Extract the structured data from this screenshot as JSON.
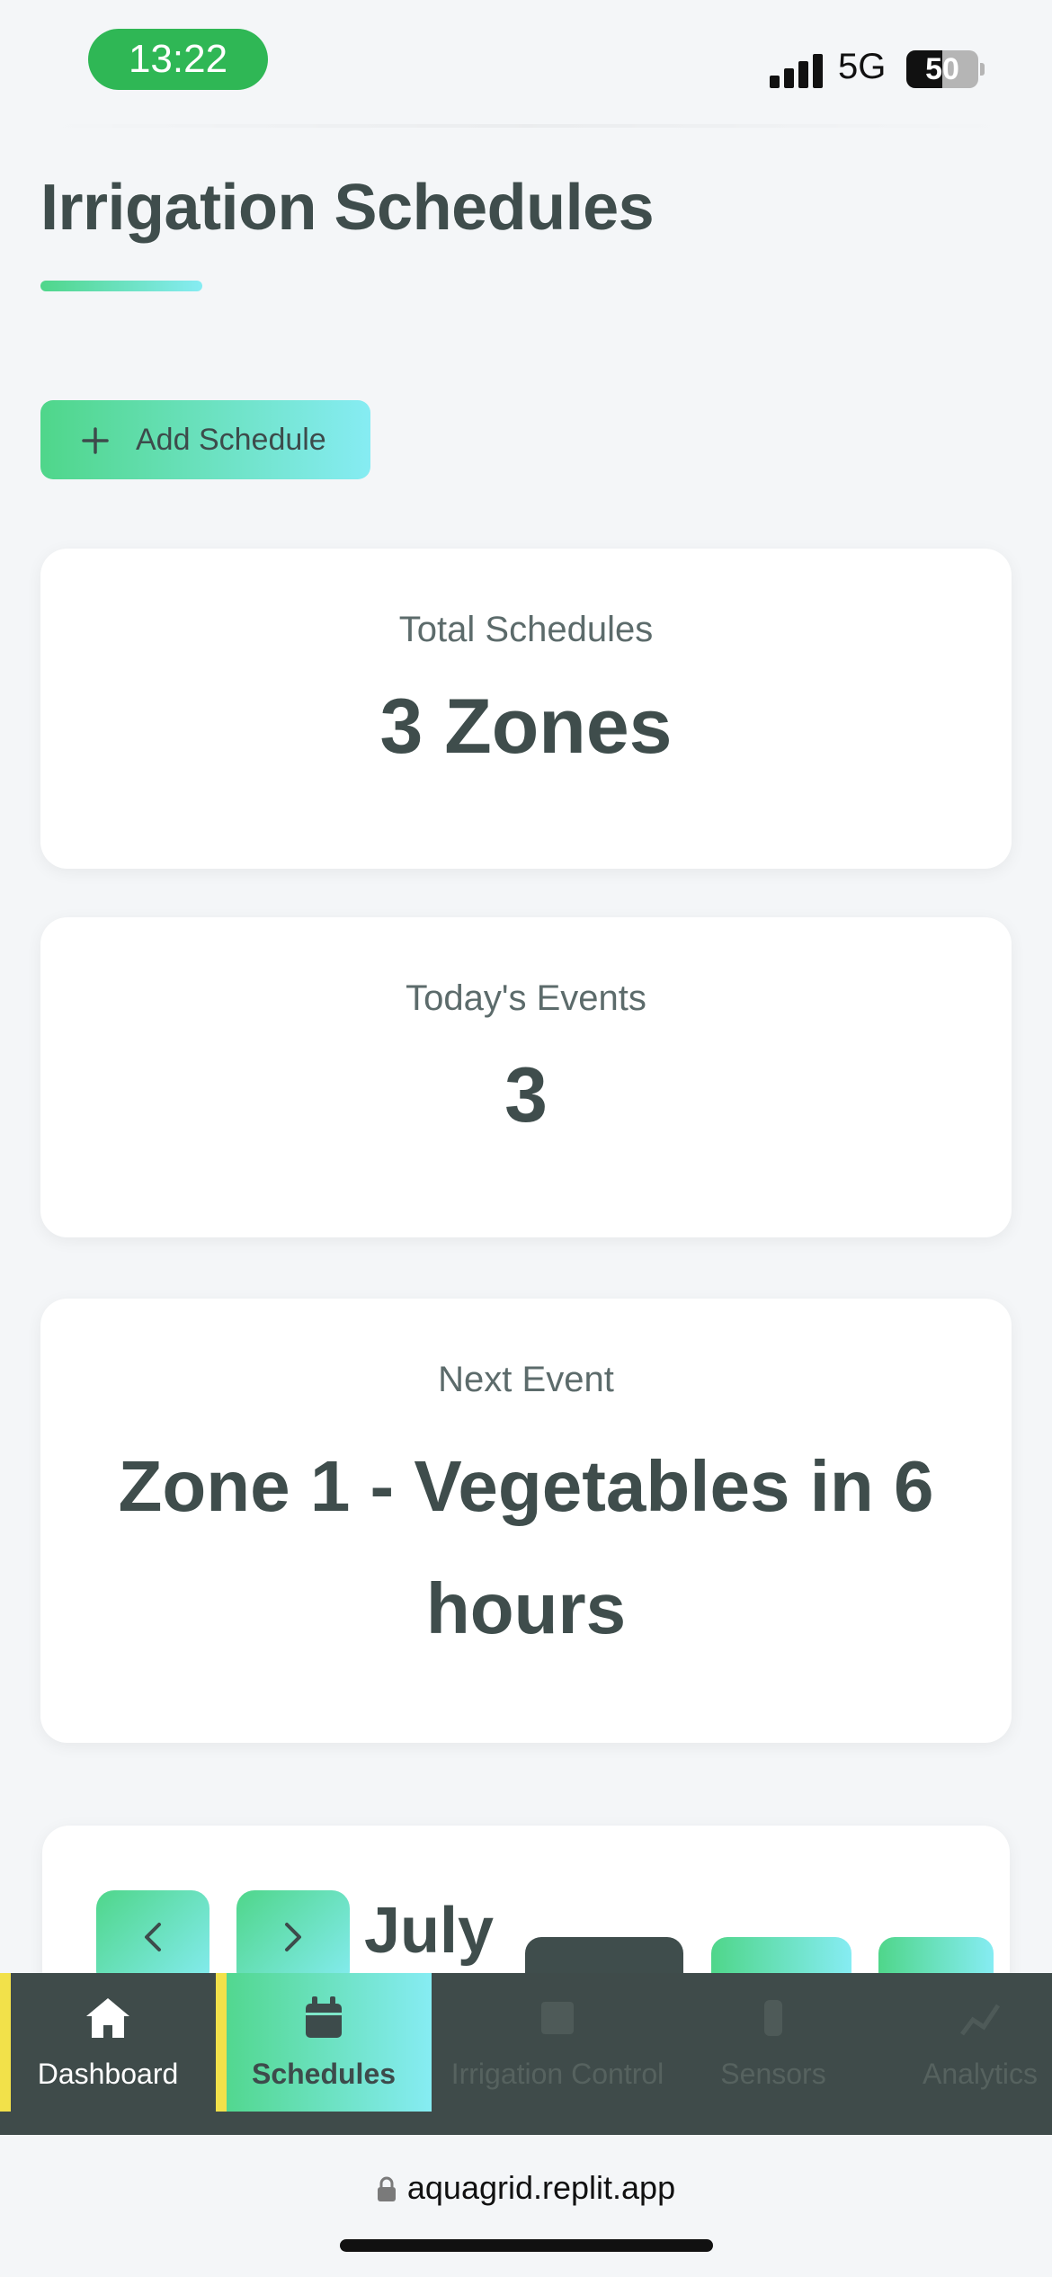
{
  "status_bar": {
    "time": "13:22",
    "network": "5G",
    "battery": "50",
    "battery_level": 0.5,
    "icons": [
      "signal-icon",
      "battery-icon"
    ]
  },
  "page": {
    "title": "Irrigation Schedules",
    "add_button_label": "Add Schedule",
    "add_button_icon": "plus-icon"
  },
  "stats": {
    "total": {
      "label": "Total Schedules",
      "value": "3 Zones"
    },
    "today": {
      "label": "Today's Events",
      "value": "3"
    },
    "next": {
      "label": "Next Event",
      "value": "Zone 1 - Vegetables in 6 hours"
    }
  },
  "calendar": {
    "month": "July",
    "prev_icon": "chevron-left-icon",
    "next_icon": "chevron-right-icon"
  },
  "bottom_nav": {
    "items": [
      {
        "label": "Dashboard",
        "icon": "home-icon"
      },
      {
        "label": "Schedules",
        "icon": "calendar-icon"
      },
      {
        "label": "Irrigation Control",
        "icon": "control-icon"
      },
      {
        "label": "Sensors",
        "icon": "sensor-icon"
      },
      {
        "label": "Analytics",
        "icon": "chart-icon"
      }
    ]
  },
  "browser": {
    "url": "aquagrid.replit.app"
  },
  "colors": {
    "accent_gradient_start": "#4fd68a",
    "accent_gradient_end": "#86ecf3",
    "dark": "#3f4b4a",
    "status_green": "#2fb755",
    "active_marker": "#f2e14a"
  }
}
